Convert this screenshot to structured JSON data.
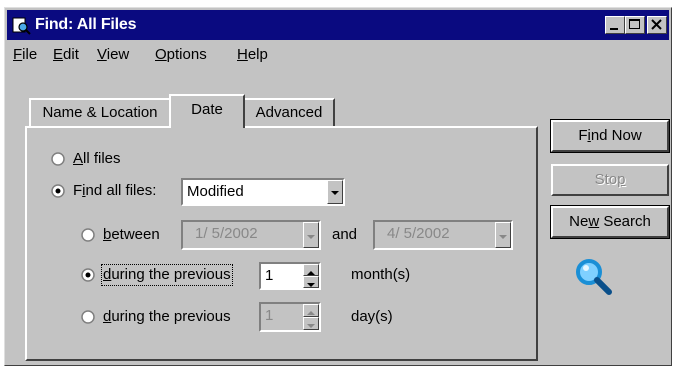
{
  "window": {
    "title": "Find: All Files"
  },
  "menu": {
    "file": {
      "accel": "F",
      "rest": "ile"
    },
    "edit": {
      "accel": "E",
      "rest": "dit"
    },
    "view": {
      "accel": "V",
      "rest": "iew"
    },
    "options": {
      "accel": "O",
      "rest": "ptions"
    },
    "help": {
      "accel": "H",
      "rest": "elp"
    }
  },
  "tabs": [
    {
      "label": "Name & Location",
      "selected": false
    },
    {
      "label": "Date",
      "selected": true
    },
    {
      "label": "Advanced",
      "selected": false
    }
  ],
  "date_tab": {
    "all_files": {
      "pre": "",
      "accel": "A",
      "post": "ll files",
      "selected": false
    },
    "find_all_files": {
      "pre": "F",
      "accel": "i",
      "post": "nd all files:",
      "selected": true
    },
    "date_type_select": {
      "value": "Modified"
    },
    "between": {
      "pre": "",
      "accel": "b",
      "post": "etween",
      "selected": false
    },
    "start_date": "1/ 5/2002",
    "and_label": "and",
    "end_date": "4/ 5/2002",
    "during_months": {
      "pre": "",
      "accel": "d",
      "post": "uring the previous",
      "selected": true,
      "value": "1",
      "unit": "month(s)"
    },
    "during_days": {
      "pre": "",
      "accel": "d",
      "post": "uring the previous",
      "selected": false,
      "value": "1",
      "unit": "day(s)"
    }
  },
  "buttons": {
    "find_now": {
      "pre": "F",
      "accel": "i",
      "post": "nd Now",
      "enabled": true
    },
    "stop": {
      "pre": "Sto",
      "accel": "p",
      "post": "",
      "enabled": false
    },
    "new_search": {
      "pre": "Ne",
      "accel": "w",
      "post": " Search",
      "enabled": true
    }
  },
  "icons": {
    "title_icon": "find-app-icon",
    "search_animation": "magnifier-icon"
  },
  "colors": {
    "titlebar": "#0a0a80",
    "face": "#c3c3c3",
    "magnifier": "#1a8fd6"
  }
}
